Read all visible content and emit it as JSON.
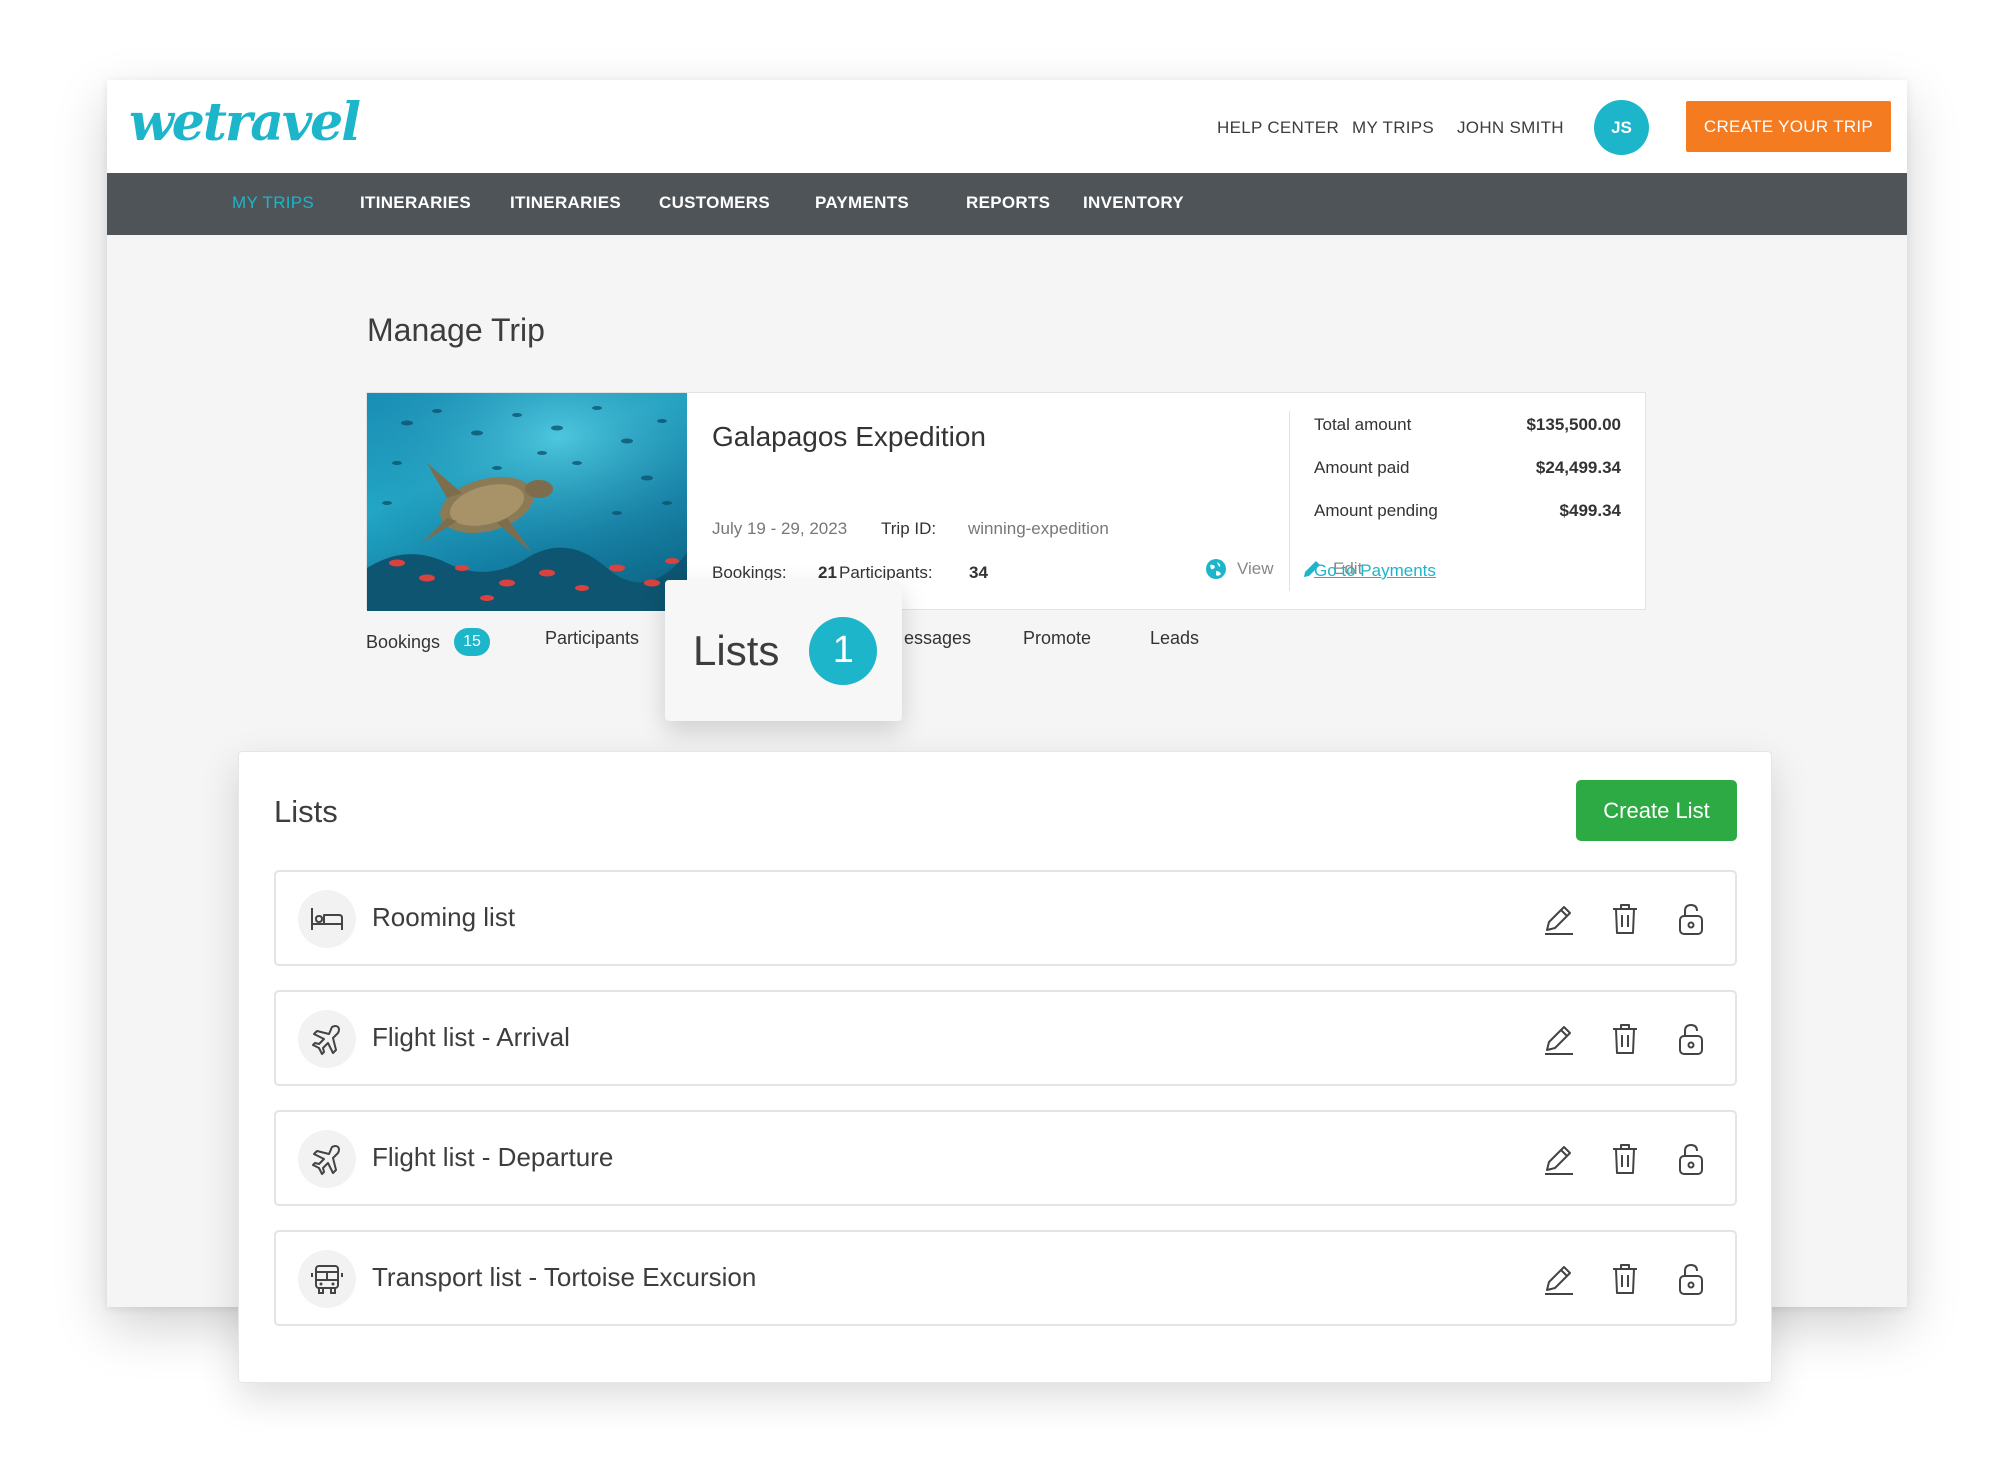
{
  "header": {
    "logo": "wetravel",
    "links": [
      "HELP CENTER",
      "MY TRIPS",
      "JOHN SMITH"
    ],
    "avatar_initials": "JS",
    "create_trip_label": "CREATE YOUR TRIP"
  },
  "nav": {
    "items": [
      "MY TRIPS",
      "ITINERARIES",
      "ITINERARIES",
      "CUSTOMERS",
      "PAYMENTS",
      "REPORTS",
      "INVENTORY"
    ],
    "active": "MY TRIPS"
  },
  "page_title": "Manage Trip",
  "trip": {
    "name": "Galapagos Expedition",
    "dates": "July 19 - 29, 2023",
    "trip_id_label": "Trip ID:",
    "trip_id": "winning-expedition",
    "bookings_label": "Bookings:",
    "bookings": "21",
    "participants_label": "Participants:",
    "participants": "34",
    "view_label": "View",
    "edit_label": "Edit",
    "amounts": [
      {
        "label": "Total amount",
        "value": "$135,500.00"
      },
      {
        "label": "Amount paid",
        "value": "$24,499.34"
      },
      {
        "label": "Amount pending",
        "value": "$499.34"
      }
    ],
    "payments_link": "Go to Payments"
  },
  "tabs": [
    {
      "label": "Bookings",
      "badge": "15"
    },
    {
      "label": "Participants"
    },
    {
      "label": "essages"
    },
    {
      "label": "Promote"
    },
    {
      "label": "Leads"
    }
  ],
  "callout": {
    "label": "Lists",
    "badge": "1"
  },
  "lists_panel": {
    "title": "Lists",
    "create_label": "Create List",
    "items": [
      {
        "label": "Rooming list",
        "icon": "bed-icon"
      },
      {
        "label": "Flight list - Arrival",
        "icon": "airplane-icon"
      },
      {
        "label": "Flight list - Departure",
        "icon": "airplane-icon"
      },
      {
        "label": "Transport list - Tortoise Excursion",
        "icon": "bus-icon"
      }
    ]
  },
  "colors": {
    "brand": "#1cb5c9",
    "cta_orange": "#f47b20",
    "nav_bg": "#4f5459",
    "create_green": "#2eaa45"
  }
}
